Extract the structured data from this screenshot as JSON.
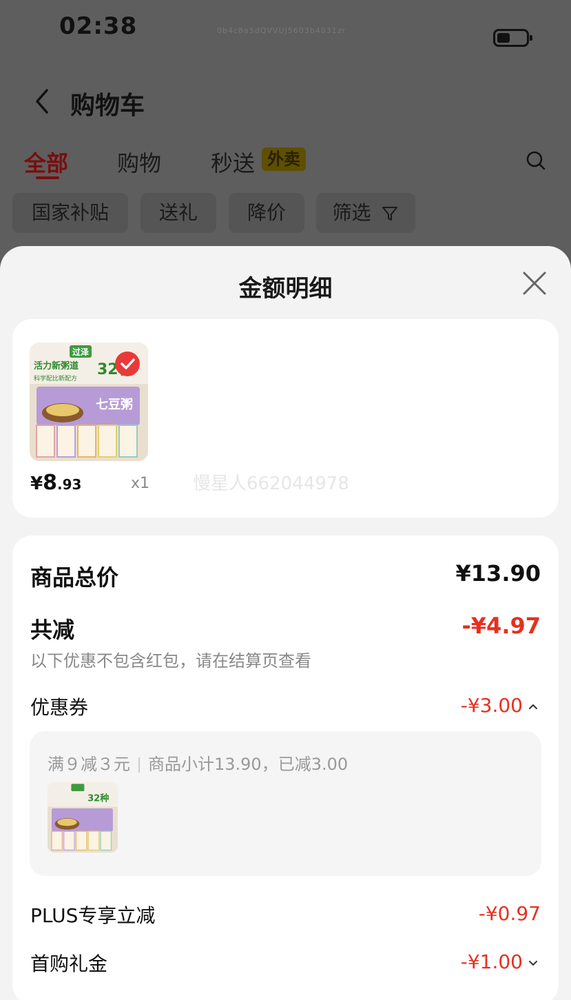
{
  "status_bar": {
    "time": "02:38",
    "device_id": "0b4c8a5dQVVUJ5603b4031zr",
    "battery_icon": "battery-icon"
  },
  "header": {
    "title": "购物车",
    "back_icon": "back-chevron-icon",
    "search_icon": "search-icon"
  },
  "tabs": [
    {
      "label": "全部",
      "active": true
    },
    {
      "label": "购物",
      "active": false
    },
    {
      "label": "秒送",
      "active": false,
      "badge": "外卖"
    }
  ],
  "filter_chips": [
    {
      "label": "国家补贴"
    },
    {
      "label": "送礼"
    },
    {
      "label": "降价"
    },
    {
      "label": "筛选",
      "icon": "funnel-icon"
    }
  ],
  "sheet": {
    "title": "金额明细",
    "close_icon": "close-icon",
    "product": {
      "image_icon": "product-image-porridge-box",
      "brand_text": "过泽",
      "image_text": [
        "活力新粥道",
        "科学配比新配方",
        "32种",
        "七豆粥"
      ],
      "selected_icon": "check-icon",
      "price_yen": "¥",
      "price_int": "8",
      "price_dec": ".93",
      "quantity": "x1",
      "watermark": "慢星人662044978"
    },
    "total_label": "商品总价",
    "total_value": "¥13.90",
    "discount_label": "共减",
    "discount_value": "-¥4.97",
    "discount_note": "以下优惠不包含红包，请在结算页查看",
    "coupon_label": "优惠券",
    "coupon_value": "-¥3.00",
    "coupon_rule": "满９减３元",
    "coupon_detail": "商品小计13.90，已减3.00",
    "plus_label": "PLUS专享立减",
    "plus_value": "-¥0.97",
    "first_buy_label": "首购礼金",
    "first_buy_value": "-¥1.00"
  },
  "colors": {
    "accent_red": "#e8301f",
    "tab_active": "#7a0d0d",
    "overlay": "#5c5c5c"
  }
}
